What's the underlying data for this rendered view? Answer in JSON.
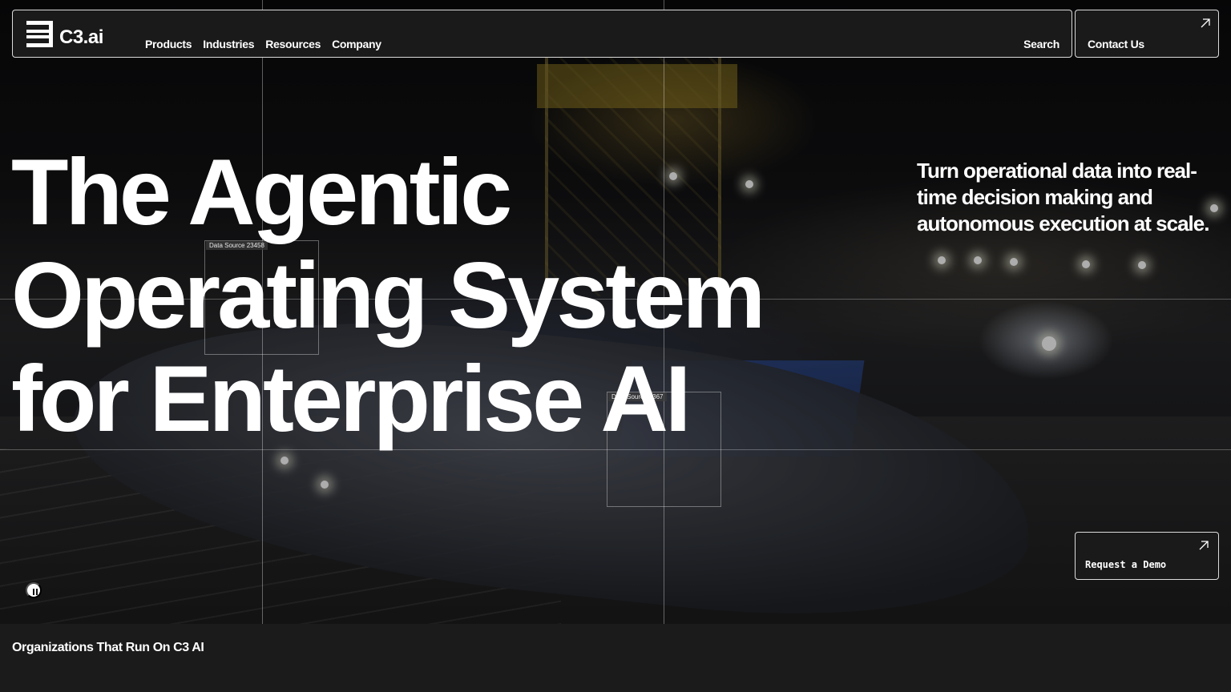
{
  "brand": {
    "name": "C3.ai"
  },
  "nav": {
    "links": [
      "Products",
      "Industries",
      "Resources",
      "Company"
    ],
    "search_label": "Search",
    "contact_label": "Contact Us"
  },
  "hero": {
    "headline": [
      "The Agentic",
      "Operating System",
      "for Enterprise AI"
    ],
    "subhead": "Turn operational data into real-time decision making and autonomous execution at scale.",
    "cta_label": "Request a Demo",
    "data_source_labels": [
      "Data Source 23458",
      "Data Source 2367"
    ]
  },
  "organizations": {
    "title": "Organizations That Run On C3 AI"
  },
  "icons": {
    "logo": "c3-logo-icon",
    "arrow": "arrow-up-right-icon",
    "pause": "pause-icon"
  },
  "colors": {
    "background": "#1b1b1b",
    "text": "#ffffff",
    "border": "#ffffff"
  }
}
